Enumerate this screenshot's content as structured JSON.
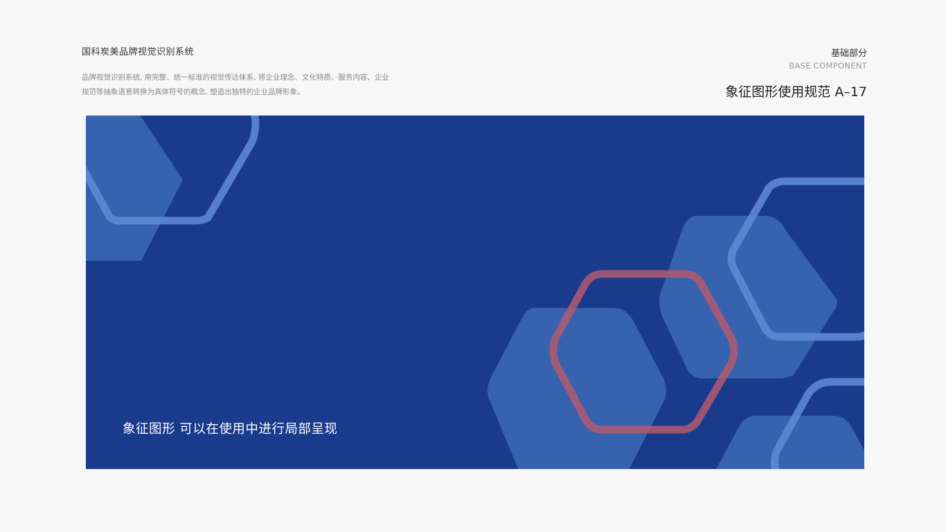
{
  "header": {
    "brand_title": "国科炭美品牌视觉识别系统",
    "description_lines": [
      "品牌视觉识别系统, 用完整、统一标准的视觉传达体系, 将企业理念、文化特质、服务内容、企业",
      "规范等抽象语意转换为具体符号的概念, 塑造出独特的企业品牌形象。"
    ],
    "section_cn": "基础部分",
    "section_en": "BASE COMPONENT",
    "page_heading": "象征图形使用规范 A–17"
  },
  "canvas": {
    "caption": "象征图形  可以在使用中进行局部呈现",
    "colors": {
      "background": "#1a3a8c",
      "hexagon_fill": "#4a7ac4",
      "hexagon_outline": "#5d8ad0",
      "accent_outline": "#b25b70"
    }
  }
}
